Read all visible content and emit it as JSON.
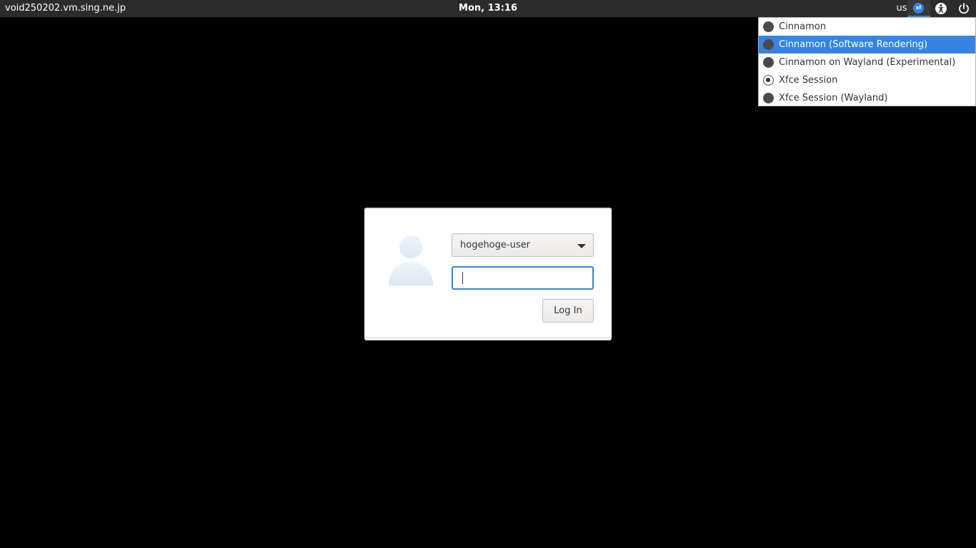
{
  "panel": {
    "hostname": "void250202.vm.sing.ne.jp",
    "clock": "Mon, 13:16",
    "keyboard_layout": "us",
    "session_icon": "xfce-icon",
    "session_badge_text": "xf",
    "accessibility_icon": "accessibility-icon",
    "power_icon": "power-icon"
  },
  "session_menu": {
    "items": [
      {
        "label": "Cinnamon",
        "selected": false,
        "highlighted": false
      },
      {
        "label": "Cinnamon (Software Rendering)",
        "selected": false,
        "highlighted": true
      },
      {
        "label": "Cinnamon on Wayland (Experimental)",
        "selected": false,
        "highlighted": false
      },
      {
        "label": "Xfce Session",
        "selected": true,
        "highlighted": false
      },
      {
        "label": "Xfce Session (Wayland)",
        "selected": false,
        "highlighted": false
      }
    ]
  },
  "login": {
    "avatar_icon": "user-avatar-icon",
    "username": "hogehoge-user",
    "password_value": "",
    "login_button_label": "Log In"
  },
  "colors": {
    "accent": "#3584e4",
    "panel_bg": "#2b2b2b",
    "desktop_bg": "#000000"
  }
}
